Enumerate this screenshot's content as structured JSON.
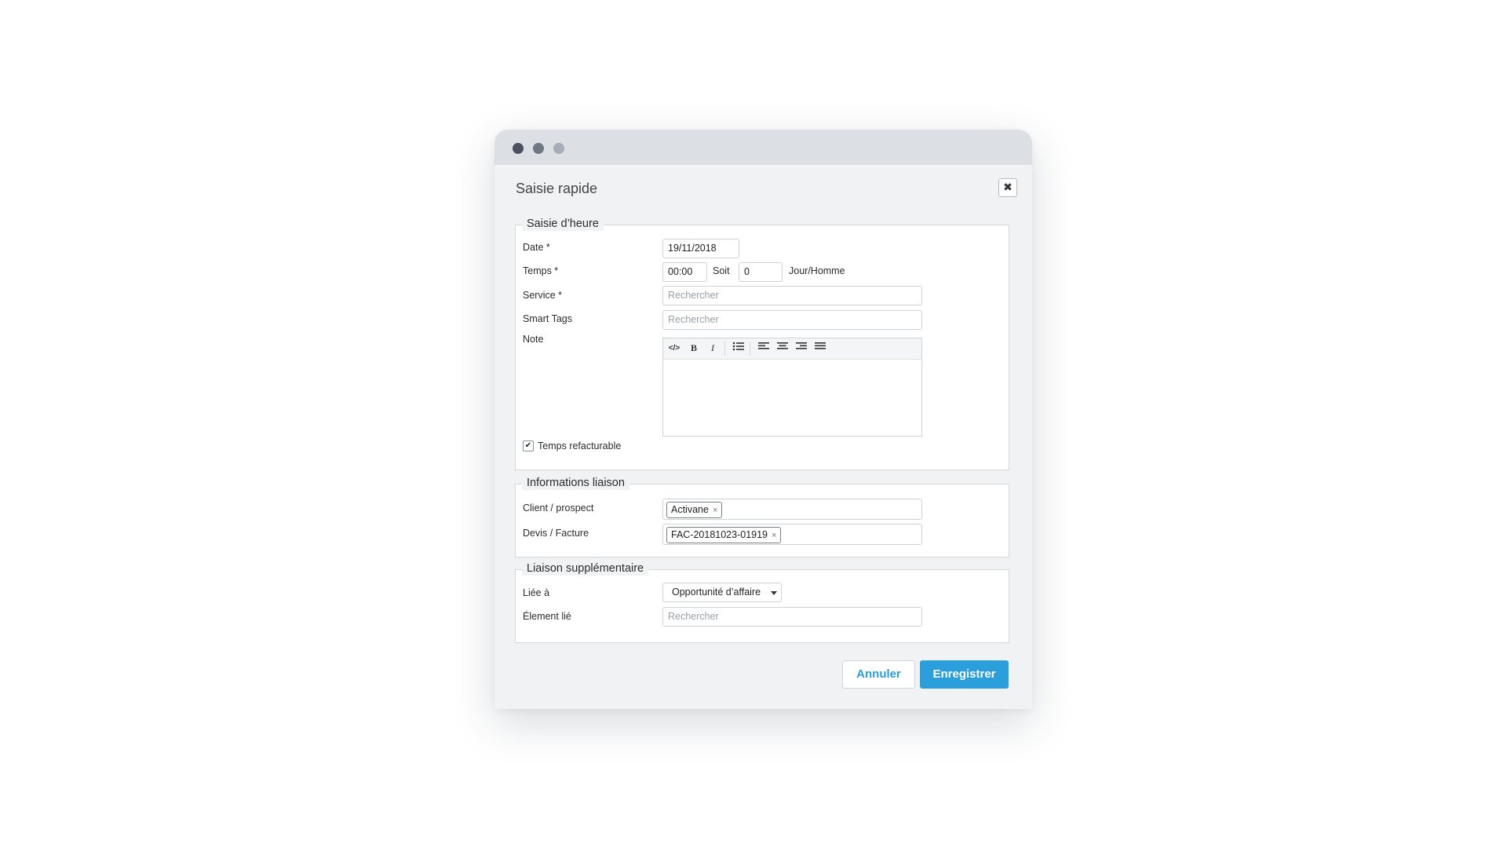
{
  "dialog": {
    "title": "Saisie rapide",
    "close_icon": "close-icon"
  },
  "section_time": {
    "legend": "Saisie d’heure",
    "date_label": "Date *",
    "date_value": "19/11/2018",
    "time_label": "Temps *",
    "time_value": "00:00",
    "soit_label": "Soit",
    "days_value": "0",
    "unit_label": "Jour/Homme",
    "service_label": "Service *",
    "service_placeholder": "Rechercher",
    "tags_label": "Smart Tags",
    "tags_placeholder": "Rechercher",
    "note_label": "Note",
    "toolbar": {
      "code": "</>",
      "bold": "B",
      "italic": "I"
    },
    "billable_label": "Temps refacturable",
    "billable_checked": true
  },
  "section_link": {
    "legend": "Informations liaison",
    "client_label": "Client / prospect",
    "client_tag": "Activane",
    "invoice_label": "Devis / Facture",
    "invoice_tag": "FAC-20181023-01919",
    "remove_symbol": "×"
  },
  "section_extra": {
    "legend": "Liaison supplémentaire",
    "linked_label": "Liée à",
    "linked_value": "Opportunité d’affaire",
    "element_label": "Élement lié",
    "element_placeholder": "Rechercher"
  },
  "actions": {
    "cancel_label": "Annuler",
    "save_label": "Enregistrer",
    "save_color": "#2a9fdc"
  },
  "checkmark": "✔"
}
